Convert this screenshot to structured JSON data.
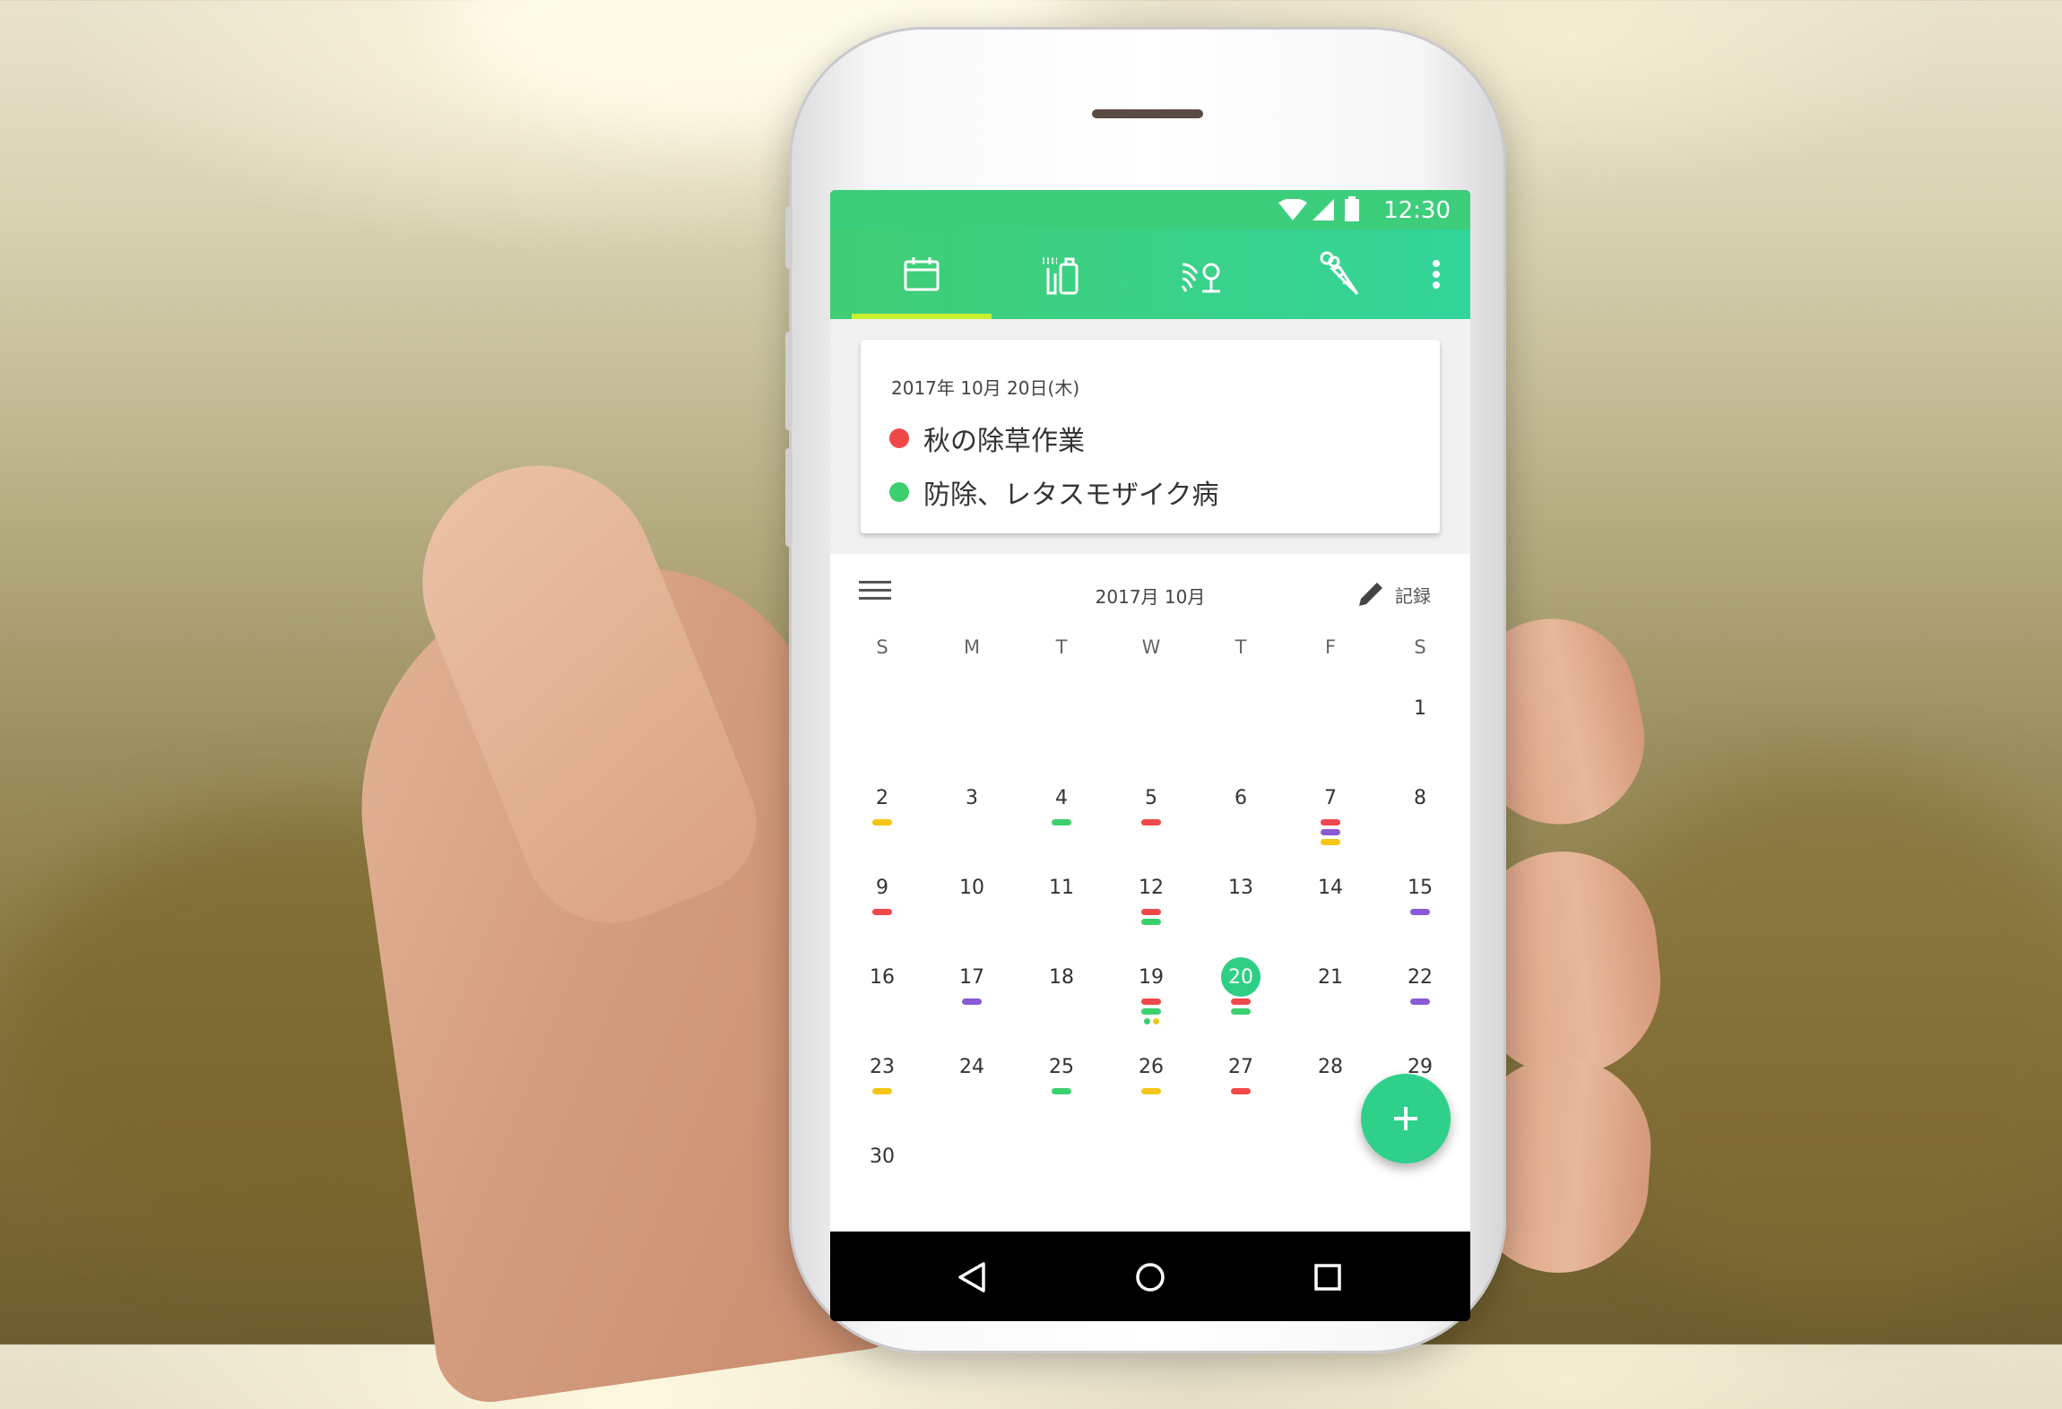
{
  "status_bar": {
    "time": "12:30"
  },
  "tabs": [
    {
      "icon": "calendar-icon",
      "selected": true
    },
    {
      "icon": "sprayer-icon",
      "selected": false
    },
    {
      "icon": "field-icon",
      "selected": false
    },
    {
      "icon": "carrot-icon",
      "selected": false
    }
  ],
  "menu_icon": "more-vert-icon",
  "summary": {
    "date": "2017年 10月 20日(木)",
    "events": [
      {
        "label": "秋の除草作業",
        "color": "#f04848"
      },
      {
        "label": "防除、レタスモザイク病",
        "color": "#3ccf6e"
      }
    ]
  },
  "calendar": {
    "title": "2017月 10月",
    "record_label": "記録",
    "weekdays": [
      "S",
      "M",
      "T",
      "W",
      "T",
      "F",
      "S"
    ],
    "today": 20,
    "colors": {
      "red": "#f04848",
      "green": "#3ccf6e",
      "yellow": "#f5c518",
      "purple": "#8a5ad6"
    },
    "weeks": [
      [
        null,
        null,
        null,
        null,
        null,
        null,
        {
          "d": 1,
          "m": []
        }
      ],
      [
        {
          "d": 2,
          "m": [
            "yellow"
          ]
        },
        {
          "d": 3,
          "m": []
        },
        {
          "d": 4,
          "m": [
            "green"
          ]
        },
        {
          "d": 5,
          "m": [
            "red"
          ]
        },
        {
          "d": 6,
          "m": []
        },
        {
          "d": 7,
          "m": [
            "red",
            "purple",
            "yellow"
          ]
        },
        {
          "d": 8,
          "m": []
        }
      ],
      [
        {
          "d": 9,
          "m": [
            "red"
          ]
        },
        {
          "d": 10,
          "m": []
        },
        {
          "d": 11,
          "m": []
        },
        {
          "d": 12,
          "m": [
            "red",
            "green"
          ]
        },
        {
          "d": 13,
          "m": []
        },
        {
          "d": 14,
          "m": []
        },
        {
          "d": 15,
          "m": [
            "purple"
          ]
        }
      ],
      [
        {
          "d": 16,
          "m": []
        },
        {
          "d": 17,
          "m": [
            "purple"
          ]
        },
        {
          "d": 18,
          "m": []
        },
        {
          "d": 19,
          "m": [
            "red",
            "green"
          ],
          "dots": [
            "green",
            "yellow"
          ]
        },
        {
          "d": 20,
          "m": [
            "red",
            "green"
          ]
        },
        {
          "d": 21,
          "m": []
        },
        {
          "d": 22,
          "m": [
            "purple"
          ]
        }
      ],
      [
        {
          "d": 23,
          "m": [
            "yellow"
          ]
        },
        {
          "d": 24,
          "m": []
        },
        {
          "d": 25,
          "m": [
            "green"
          ]
        },
        {
          "d": 26,
          "m": [
            "yellow"
          ]
        },
        {
          "d": 27,
          "m": [
            "red"
          ]
        },
        {
          "d": 28,
          "m": []
        },
        {
          "d": 29,
          "m": []
        }
      ],
      [
        {
          "d": 30,
          "m": []
        },
        null,
        null,
        null,
        null,
        null,
        null
      ]
    ]
  },
  "fab": {
    "icon": "plus-icon"
  },
  "nav": {
    "back": "back-icon",
    "home": "home-icon",
    "recents": "recents-icon"
  }
}
